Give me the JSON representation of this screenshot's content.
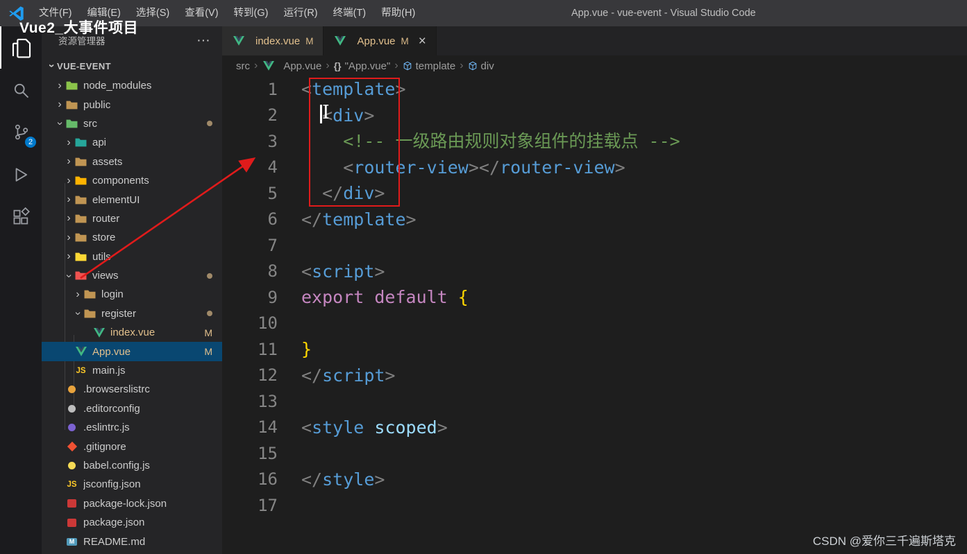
{
  "window": {
    "title": "App.vue - vue-event - Visual Studio Code"
  },
  "overlay": {
    "title": "Vue2_大事件项目",
    "watermark": "CSDN @爱你三千遍斯塔克"
  },
  "menu_items": [
    "文件(F)",
    "编辑(E)",
    "选择(S)",
    "查看(V)",
    "转到(G)",
    "运行(R)",
    "终端(T)",
    "帮助(H)"
  ],
  "activity_bar": {
    "items": [
      {
        "icon": "files-icon",
        "active": true
      },
      {
        "icon": "search-icon"
      },
      {
        "icon": "source-control-icon",
        "badge": "2"
      },
      {
        "icon": "run-debug-icon"
      },
      {
        "icon": "extensions-icon"
      }
    ]
  },
  "sidebar": {
    "header": "资源管理器",
    "header_actions": "···",
    "section_label": "VUE-EVENT",
    "tree": [
      {
        "label": "node_modules",
        "level": 0,
        "chevron": "collapsed",
        "icon": "folder-node-modules"
      },
      {
        "label": "public",
        "level": 0,
        "chevron": "collapsed",
        "icon": "folder-public"
      },
      {
        "label": "src",
        "level": 0,
        "chevron": "expanded",
        "icon": "folder-src",
        "dot": true
      },
      {
        "label": "api",
        "level": 1,
        "chevron": "collapsed",
        "icon": "folder-api"
      },
      {
        "label": "assets",
        "level": 1,
        "chevron": "collapsed",
        "icon": "folder-assets"
      },
      {
        "label": "components",
        "level": 1,
        "chevron": "collapsed",
        "icon": "folder-components"
      },
      {
        "label": "elementUI",
        "level": 1,
        "chevron": "collapsed",
        "icon": "folder-elementui"
      },
      {
        "label": "router",
        "level": 1,
        "chevron": "collapsed",
        "icon": "folder-router"
      },
      {
        "label": "store",
        "level": 1,
        "chevron": "collapsed",
        "icon": "folder-store"
      },
      {
        "label": "utils",
        "level": 1,
        "chevron": "collapsed",
        "icon": "folder-utils"
      },
      {
        "label": "views",
        "level": 1,
        "chevron": "expanded",
        "icon": "folder-views",
        "dot": true
      },
      {
        "label": "login",
        "level": 2,
        "chevron": "collapsed",
        "icon": "folder-login"
      },
      {
        "label": "register",
        "level": 2,
        "chevron": "expanded",
        "icon": "folder-register",
        "dot": true
      },
      {
        "label": "index.vue",
        "level": 3,
        "icon": "vue-icon",
        "badge": "M",
        "modified": true
      },
      {
        "label": "App.vue",
        "level": 1,
        "icon": "vue-icon",
        "badge": "M",
        "modified": true,
        "selected": true
      },
      {
        "label": "main.js",
        "level": 1,
        "icon": "js-icon"
      },
      {
        "label": ".browserslistrc",
        "level": 0,
        "icon": "browserslist-icon"
      },
      {
        "label": ".editorconfig",
        "level": 0,
        "icon": "editorconfig-icon"
      },
      {
        "label": ".eslintrc.js",
        "level": 0,
        "icon": "eslint-icon"
      },
      {
        "label": ".gitignore",
        "level": 0,
        "icon": "git-icon"
      },
      {
        "label": "babel.config.js",
        "level": 0,
        "icon": "babel-icon"
      },
      {
        "label": "jsconfig.json",
        "level": 0,
        "icon": "js-icon"
      },
      {
        "label": "package-lock.json",
        "level": 0,
        "icon": "npm-icon"
      },
      {
        "label": "package.json",
        "level": 0,
        "icon": "npm-icon"
      },
      {
        "label": "README.md",
        "level": 0,
        "icon": "md-icon"
      }
    ]
  },
  "tabs": [
    {
      "label": "index.vue",
      "icon": "vue-icon",
      "git_badge": "M",
      "active": false
    },
    {
      "label": "App.vue",
      "icon": "vue-icon",
      "git_badge": "M",
      "close": "×",
      "active": true
    }
  ],
  "breadcrumb": [
    {
      "label": "src"
    },
    {
      "icon": "vue-icon",
      "label": "App.vue"
    },
    {
      "icon": "braces-icon",
      "label": "\"App.vue\""
    },
    {
      "icon": "symbol-icon",
      "label": "template"
    },
    {
      "icon": "symbol-icon",
      "label": "div"
    }
  ],
  "editor": {
    "lines": [
      {
        "num": "1",
        "tokens": [
          [
            "<",
            "p"
          ],
          [
            "template",
            "tag"
          ],
          [
            ">",
            "p"
          ]
        ]
      },
      {
        "num": "2",
        "tokens": [
          [
            "  ",
            "d"
          ],
          [
            "<",
            "p"
          ],
          [
            "div",
            "tag"
          ],
          [
            ">",
            "p"
          ]
        ]
      },
      {
        "num": "3",
        "tokens": [
          [
            "    ",
            "d"
          ],
          [
            "<!-- 一级路由规则对象组件的挂载点 -->",
            "cm"
          ]
        ]
      },
      {
        "num": "4",
        "tokens": [
          [
            "    ",
            "d"
          ],
          [
            "<",
            "p"
          ],
          [
            "router-view",
            "tag"
          ],
          [
            "></",
            "p"
          ],
          [
            "router-view",
            "tag"
          ],
          [
            ">",
            "p"
          ]
        ]
      },
      {
        "num": "5",
        "tokens": [
          [
            "  ",
            "d"
          ],
          [
            "</",
            "p"
          ],
          [
            "div",
            "tag"
          ],
          [
            ">",
            "p"
          ]
        ]
      },
      {
        "num": "6",
        "tokens": [
          [
            "</",
            "p"
          ],
          [
            "template",
            "tag"
          ],
          [
            ">",
            "p"
          ]
        ]
      },
      {
        "num": "7",
        "tokens": []
      },
      {
        "num": "8",
        "tokens": [
          [
            "<",
            "p"
          ],
          [
            "script",
            "tag"
          ],
          [
            ">",
            "p"
          ]
        ]
      },
      {
        "num": "9",
        "tokens": [
          [
            "export",
            "kw"
          ],
          [
            " ",
            "d"
          ],
          [
            "default",
            "kw"
          ],
          [
            " ",
            "d"
          ],
          [
            "{",
            "br"
          ]
        ]
      },
      {
        "num": "10",
        "tokens": []
      },
      {
        "num": "11",
        "tokens": [
          [
            "}",
            "br"
          ]
        ]
      },
      {
        "num": "12",
        "tokens": [
          [
            "</",
            "p"
          ],
          [
            "script",
            "tag"
          ],
          [
            ">",
            "p"
          ]
        ]
      },
      {
        "num": "13",
        "tokens": []
      },
      {
        "num": "14",
        "tokens": [
          [
            "<",
            "p"
          ],
          [
            "style",
            "tag"
          ],
          [
            " ",
            "d"
          ],
          [
            "scoped",
            "at"
          ],
          [
            ">",
            "p"
          ]
        ]
      },
      {
        "num": "15",
        "tokens": []
      },
      {
        "num": "16",
        "tokens": [
          [
            "</",
            "p"
          ],
          [
            "style",
            "tag"
          ],
          [
            ">",
            "p"
          ]
        ]
      },
      {
        "num": "17",
        "tokens": []
      }
    ]
  },
  "colors": {
    "annotation_red": "#e01b1b",
    "git_modified": "#e2c08d",
    "badge_blue": "#007acc",
    "selection_blue": "#094771",
    "tag_blue": "#569cd6",
    "comment_green": "#6a9955",
    "keyword_magenta": "#c586c0"
  }
}
